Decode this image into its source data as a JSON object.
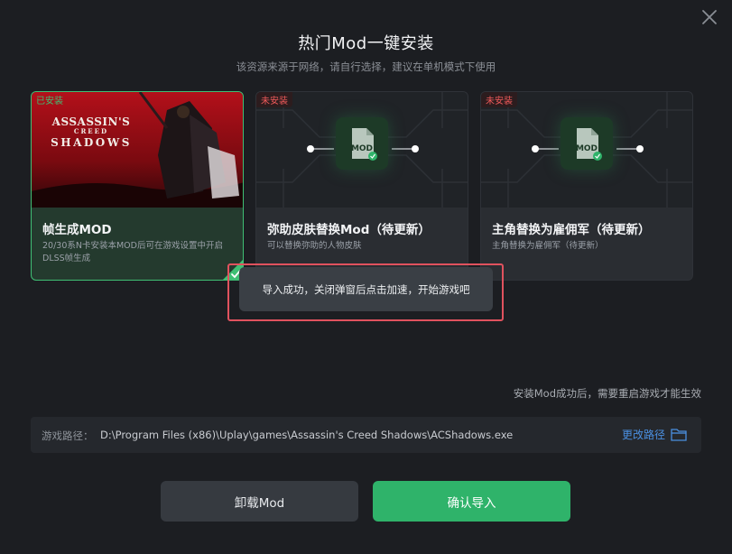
{
  "dialog": {
    "title": "热门Mod一键安装",
    "subtitle": "该资源来源于网络，请自行选择，建议在单机模式下使用"
  },
  "cards": [
    {
      "badge": "已安装",
      "title": "帧生成MOD",
      "desc": "20/30系N卡安装本MOD后可在游戏设置中开启DLSS帧生成",
      "art_line1": "ASSASSIN'S",
      "art_line2": "CREED",
      "art_line3": "SHADOWS",
      "selected": true
    },
    {
      "badge": "未安装",
      "title": "弥助皮肤替换Mod（待更新）",
      "desc": "可以替换弥助的人物皮肤",
      "tile_label": "MOD"
    },
    {
      "badge": "未安装",
      "title": "主角替换为雇佣军（待更新）",
      "desc": "主角替换为雇佣军（待更新）",
      "tile_label": "MOD"
    }
  ],
  "toast": {
    "message": "导入成功，关闭弹窗后点击加速，开始游戏吧"
  },
  "hint": "安装Mod成功后，需要重启游戏才能生效",
  "path": {
    "label": "游戏路径：",
    "value": "D:\\Program Files (x86)\\Uplay\\games\\Assassin's Creed Shadows\\ACShadows.exe",
    "change_label": "更改路径"
  },
  "buttons": {
    "uninstall": "卸载Mod",
    "confirm": "确认导入"
  },
  "colors": {
    "accent_green": "#2fb36a",
    "installed_green": "#3fbf74",
    "not_installed_red": "#f05a5a",
    "link_blue": "#4a8fe0",
    "highlight_red": "#e0525e"
  }
}
